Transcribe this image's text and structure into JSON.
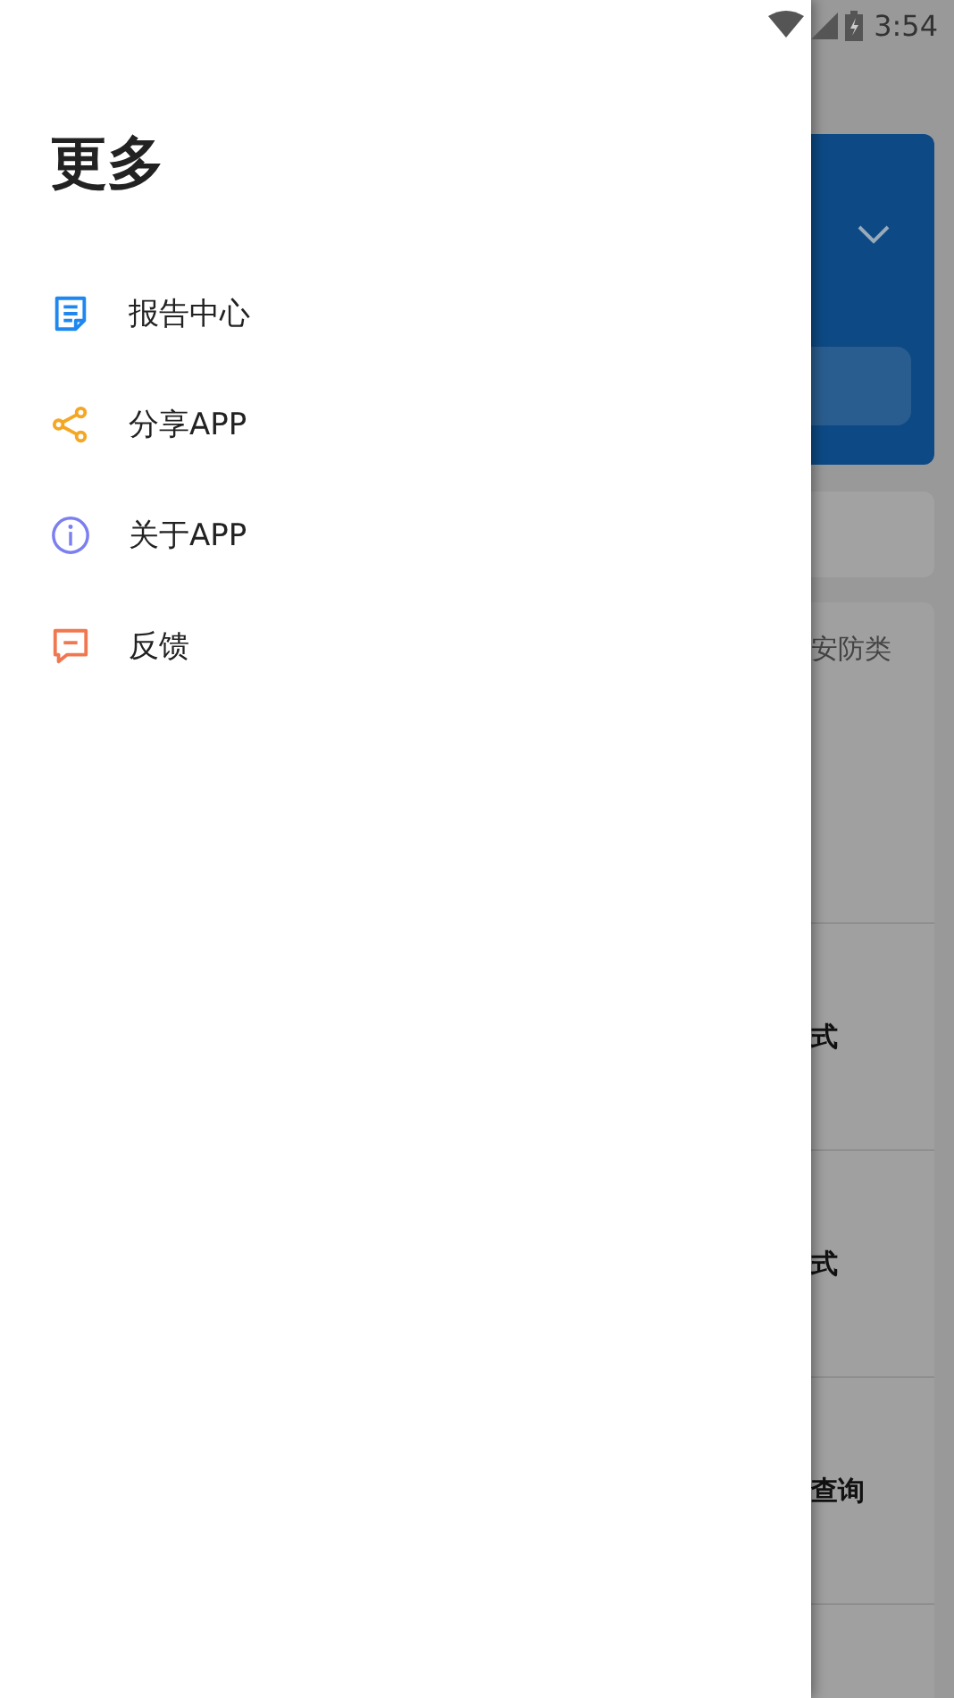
{
  "status_bar": {
    "time": "3:54"
  },
  "drawer": {
    "title": "更多",
    "items": [
      {
        "label": "报告中心",
        "kind": "report"
      },
      {
        "label": "分享APP",
        "kind": "share"
      },
      {
        "label": "关于APP",
        "kind": "info"
      },
      {
        "label": "反馈",
        "kind": "feedback"
      }
    ]
  },
  "background": {
    "category": "安防类",
    "rows": [
      "式",
      "式",
      "查询"
    ]
  }
}
